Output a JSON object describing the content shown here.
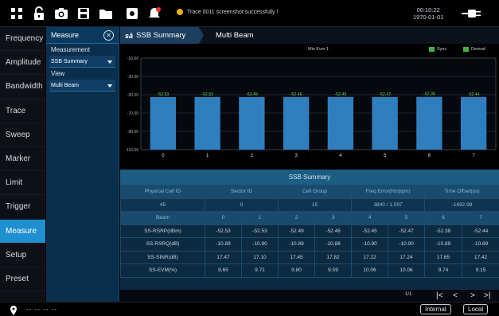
{
  "toolbar": {
    "message": "Trace 0011 screenshot successfully !",
    "time": "00:10:22",
    "date": "1970-01-01"
  },
  "sidebar": {
    "items": [
      {
        "label": "Frequency",
        "active": false
      },
      {
        "label": "Amplitude",
        "active": false
      },
      {
        "label": "Bandwidth",
        "active": false
      },
      {
        "label": "Trace",
        "active": false
      },
      {
        "label": "Sweep",
        "active": false
      },
      {
        "label": "Marker",
        "active": false
      },
      {
        "label": "Limit",
        "active": false
      },
      {
        "label": "Trigger",
        "active": false
      },
      {
        "label": "Measure",
        "active": true
      },
      {
        "label": "Setup",
        "active": false
      },
      {
        "label": "Preset",
        "active": false
      }
    ]
  },
  "panel": {
    "title": "Measure",
    "measurement_label": "Measurement",
    "measurement_value": "SSB Summary",
    "view_label": "View",
    "view_value": "Multi Beam"
  },
  "tabs": {
    "logo": "sā",
    "active": "SSB Summary",
    "second": "Multi Beam"
  },
  "chart_data": {
    "type": "bar",
    "title": "Min Evm 1",
    "categories": [
      "0",
      "1",
      "2",
      "3",
      "4",
      "5",
      "6",
      "7"
    ],
    "values": [
      -52.53,
      -52.53,
      -52.49,
      -52.46,
      -52.45,
      -52.47,
      -52.38,
      -52.44
    ],
    "value_labels": [
      "-52.53",
      "-52.53",
      "-52.49",
      "-52.46",
      "-52.45",
      "-52.47",
      "-52.38",
      "-52.44"
    ],
    "yticks": [
      "-10.00",
      "-30.00",
      "-50.00",
      "-70.00",
      "-90.00",
      "-110.00"
    ],
    "ylim": [
      -110,
      -10
    ],
    "legend": [
      {
        "name": "Sync",
        "color": "#46b23c"
      },
      {
        "name": "Demod",
        "color": "#46b23c"
      }
    ],
    "bar_color": "#2f7fbf",
    "grid": true
  },
  "summary": {
    "title": "SSB Summary",
    "header": [
      "Physical Cell ID",
      "Sector ID",
      "Cell Group",
      "Freq Error(Hz/ppm)",
      "Time Offset(us)"
    ],
    "values": [
      "45",
      "0",
      "15",
      "3840 / 1.097",
      "-1692.98"
    ],
    "beam_header": [
      "Beam",
      "0",
      "1",
      "2",
      "3",
      "4",
      "5",
      "6",
      "7"
    ],
    "rows": [
      [
        "SS-RSRP(dBm)",
        "-52.53",
        "-52.53",
        "-52.49",
        "-52.46",
        "-52.45",
        "-52.47",
        "-52.38",
        "-52.44"
      ],
      [
        "SS-RSRQ(dB)",
        "-10.89",
        "-10.90",
        "-10.89",
        "-10.88",
        "-10.90",
        "-10.90",
        "-10.89",
        "-10.89"
      ],
      [
        "SS-SINR(dB)",
        "17.47",
        "17.10",
        "17.45",
        "17.82",
        "17.22",
        "17.24",
        "17.65",
        "17.42"
      ],
      [
        "SS-EVM(%)",
        "9.65",
        "9.71",
        "9.80",
        "9.59",
        "10.06",
        "10.06",
        "9.74",
        "9.15"
      ]
    ]
  },
  "pager": {
    "count": "1/1",
    "first": "|<",
    "prev": "<",
    "next": ">",
    "last": ">|"
  },
  "status": {
    "coord": "-- -- -- --",
    "internal": "Internal",
    "local": "Local"
  }
}
